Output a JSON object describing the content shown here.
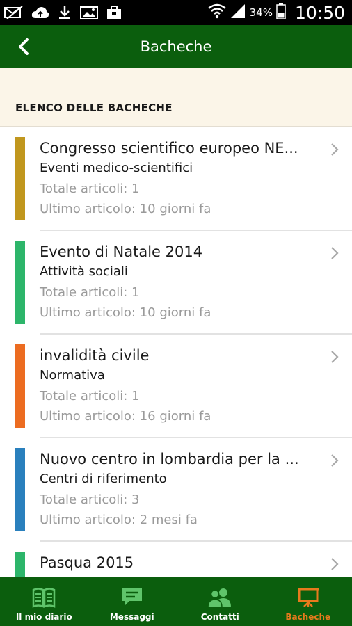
{
  "status_bar": {
    "battery": "34%",
    "time": "10:50"
  },
  "header": {
    "title": "Bacheche"
  },
  "section": {
    "label": "ELENCO DELLE BACHECHE"
  },
  "colors": {
    "primary": "#0b5e0d",
    "active_tab": "#e87a1d",
    "section_bg": "#fbf5e8"
  },
  "boards": [
    {
      "title": "Congresso scientifico europeo NE...",
      "category": "Eventi medico-scientifici",
      "total": "Totale articoli: 1",
      "last": "Ultimo articolo: 10 giorni fa",
      "color": "#c1971e"
    },
    {
      "title": "Evento di Natale 2014",
      "category": "Attività sociali",
      "total": "Totale articoli: 1",
      "last": "Ultimo articolo: 10 giorni fa",
      "color": "#2db56a"
    },
    {
      "title": "invalidità civile",
      "category": "Normativa",
      "total": "Totale articoli: 1",
      "last": "Ultimo articolo: 16 giorni fa",
      "color": "#ec6c21"
    },
    {
      "title": "Nuovo centro in lombardia per la ...",
      "category": "Centri di riferimento",
      "total": "Totale articoli: 3",
      "last": "Ultimo articolo: 2 mesi fa",
      "color": "#2a80bd"
    },
    {
      "title": "Pasqua 2015",
      "category": "",
      "total": "",
      "last": "",
      "color": "#2db56a"
    }
  ],
  "nav": {
    "items": [
      {
        "label": "Il mio diario",
        "icon": "book-icon"
      },
      {
        "label": "Messaggi",
        "icon": "chat-icon"
      },
      {
        "label": "Contatti",
        "icon": "contacts-icon"
      },
      {
        "label": "Bacheche",
        "icon": "board-icon"
      }
    ],
    "active": "Bacheche"
  }
}
